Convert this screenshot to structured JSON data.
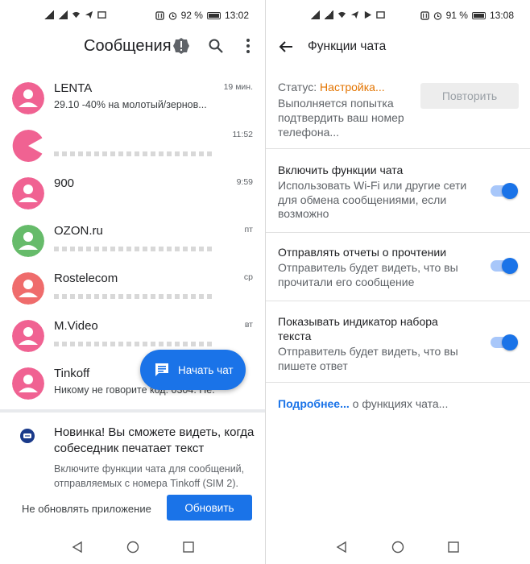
{
  "left_screen": {
    "status_bar": {
      "battery": "92 %",
      "time": "13:02"
    },
    "app_bar": {
      "title": "Сообщения"
    },
    "conversations": [
      {
        "name": "LENTA",
        "snippet": "29.10 -40% на молотый/зернов...",
        "time": "19 мин.",
        "avatar_color": "#f06292"
      },
      {
        "name": "",
        "snippet": "",
        "time": "11:52",
        "avatar_color": "#f06292"
      },
      {
        "name": "900",
        "snippet": "",
        "time": "9:59",
        "avatar_color": "#f06292"
      },
      {
        "name": "OZON.ru",
        "snippet": "",
        "time": "пт",
        "avatar_color": "#66bb6a"
      },
      {
        "name": "Rostelecom",
        "snippet": "",
        "time": "ср",
        "avatar_color": "#ef6c6c"
      },
      {
        "name": "M.Video",
        "snippet": "",
        "time": "вт",
        "avatar_color": "#f06292"
      },
      {
        "name": "Tinkoff",
        "snippet": "Никому не говорите код: 0304. Не...",
        "time": "",
        "avatar_color": "#f06292"
      }
    ],
    "fab": {
      "label": "Начать чат"
    },
    "promo": {
      "title": "Новинка! Вы сможете видеть, когда собеседник печатает текст",
      "body": "Включите функции чата для сообщений, отправляемых с номера Tinkoff (SIM 2).",
      "dismiss_label": "Не обновлять приложение",
      "update_label": "Обновить"
    }
  },
  "right_screen": {
    "status_bar": {
      "battery": "91 %",
      "time": "13:08"
    },
    "app_bar": {
      "title": "Функции чата"
    },
    "status": {
      "label": "Статус:",
      "value": "Настройка...",
      "description": "Выполняется попытка подтвердить ваш номер телефона...",
      "retry_label": "Повторить"
    },
    "settings": [
      {
        "title": "Включить функции чата",
        "description": "Использовать Wi-Fi или другие сети для обмена сообщениями, если возможно",
        "enabled": true
      },
      {
        "title": "Отправлять отчеты о прочтении",
        "description": "Отправитель будет видеть, что вы прочитали его сообщение",
        "enabled": true
      },
      {
        "title": "Показывать индикатор набора текста",
        "description": "Отправитель будет видеть, что вы пишете ответ",
        "enabled": true
      }
    ],
    "more_link": {
      "link_text": "Подробнее...",
      "rest_text": " о функциях чата..."
    }
  },
  "colors": {
    "accent": "#1a73e8",
    "status_orange": "#e37400",
    "avatar_pink": "#f06292",
    "avatar_green": "#66bb6a",
    "avatar_red": "#ef6c6c"
  }
}
